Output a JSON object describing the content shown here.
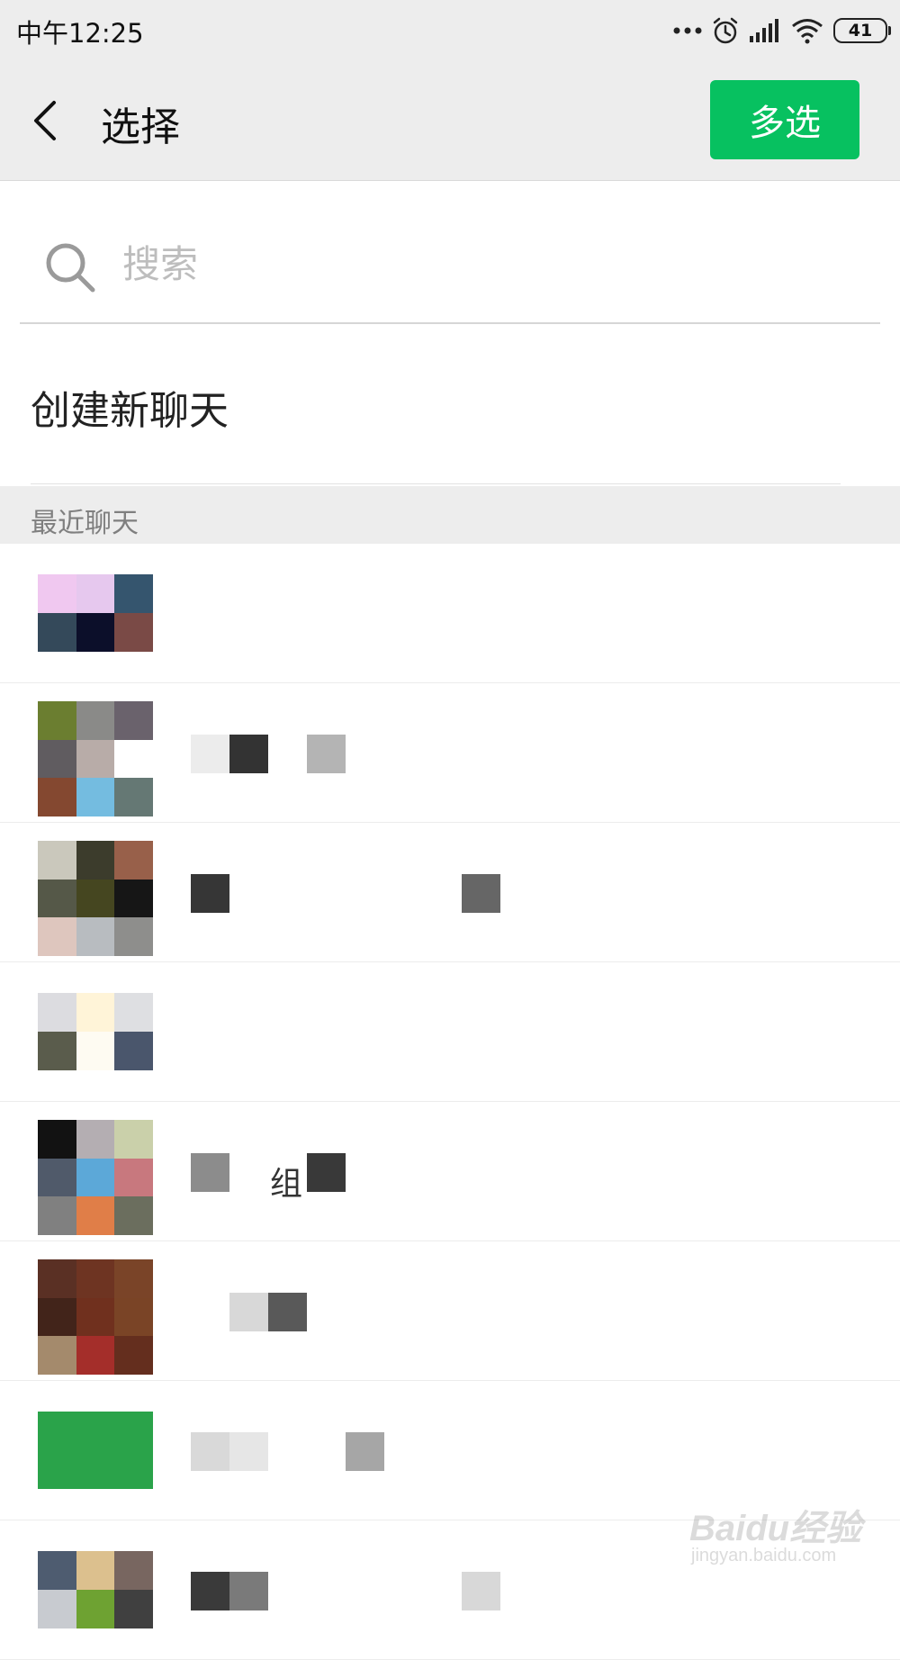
{
  "status_bar": {
    "time": "中午12:25",
    "battery": "41",
    "icons": [
      "more-dots-icon",
      "alarm-icon",
      "signal-icon",
      "wifi-icon",
      "battery-icon"
    ]
  },
  "nav": {
    "title": "选择",
    "multi_select_label": "多选",
    "back_icon": "back-chevron-icon",
    "accent_color": "#07c160"
  },
  "search": {
    "placeholder": "搜索",
    "value": ""
  },
  "new_chat_label": "创建新聊天",
  "recent_header": "最近聊天",
  "chats": [
    {
      "name": "",
      "avatar": [
        "#f0c8f0",
        "#e6c8ee",
        "#35556e",
        "#34495a",
        "#0c0f2a",
        "#7a4a46",
        "#ffffff",
        "#ffffff",
        "#ffffff"
      ],
      "avatar_rows": 2,
      "blocks": []
    },
    {
      "name": "",
      "avatar": [
        "#6b7e30",
        "#8a8a88",
        "#6a626c",
        "#605c60",
        "#b8aca8",
        "#ffffff",
        "#844830",
        "#74bce0",
        "#657874"
      ],
      "avatar_rows": 3,
      "blocks": [
        {
          "i": 0,
          "c": "#ececec"
        },
        {
          "i": 1,
          "c": "#333333"
        },
        {
          "i": 3,
          "c": "#b4b4b4"
        }
      ]
    },
    {
      "name": "",
      "avatar": [
        "#cac8bc",
        "#3c3c2c",
        "#98604a",
        "#555848",
        "#454620",
        "#161616",
        "#dec6be",
        "#b8bcc0",
        "#8e8e8c"
      ],
      "avatar_rows": 3,
      "blocks": [
        {
          "i": 0,
          "c": "#363636"
        },
        {
          "i": 7,
          "c": "#666666"
        }
      ]
    },
    {
      "name": "",
      "avatar": [
        "#dcdce0",
        "#fff4d8",
        "#dedfe2",
        "#5a5c4c",
        "#fefbf2",
        "#4a566c",
        "#ffffff",
        "#ffffff",
        "#ffffff"
      ],
      "avatar_rows": 2,
      "blocks": []
    },
    {
      "name": "组",
      "avatar": [
        "#121212",
        "#b4aeb2",
        "#cad0aa",
        "#505a6a",
        "#5ca8d8",
        "#c8787e",
        "#808080",
        "#e07e48",
        "#6b6e5e"
      ],
      "avatar_rows": 3,
      "blocks": [
        {
          "i": 0,
          "c": "#8c8c8c"
        },
        {
          "i": 3,
          "c": "#393939"
        }
      ]
    },
    {
      "name": "",
      "avatar": [
        "#5a3024",
        "#6e3422",
        "#7a4428",
        "#42241a",
        "#70301e",
        "#7a4426",
        "#a48a6c",
        "#a42e2a",
        "#642e1e"
      ],
      "avatar_rows": 3,
      "blocks": [
        {
          "i": 1,
          "c": "#d8d8d8"
        },
        {
          "i": 2,
          "c": "#595959"
        }
      ]
    },
    {
      "name": "",
      "avatar": [
        "#2aa34a",
        "#2aa34a",
        "#2aa34a",
        "#2aa34a",
        "#2aa34a",
        "#2aa34a",
        "#2aa34a",
        "#2aa34a",
        "#2aa34a"
      ],
      "avatar_rows": 2,
      "blocks": [
        {
          "i": 0,
          "c": "#d9d9d9"
        },
        {
          "i": 1,
          "c": "#e6e6e6"
        },
        {
          "i": 4,
          "c": "#a6a6a6"
        }
      ]
    },
    {
      "name": "",
      "avatar": [
        "#4e5c70",
        "#dcc08e",
        "#786660",
        "#c8cbd0",
        "#6ea232",
        "#404040",
        "#ffffff",
        "#ffffff",
        "#ffffff"
      ],
      "avatar_rows": 2,
      "blocks": [
        {
          "i": 0,
          "c": "#3a3a3a"
        },
        {
          "i": 1,
          "c": "#7a7a7a"
        },
        {
          "i": 7,
          "c": "#d8d8d8"
        }
      ]
    }
  ],
  "watermark": {
    "main": "Baidu经验",
    "sub": "jingyan.baidu.com"
  }
}
